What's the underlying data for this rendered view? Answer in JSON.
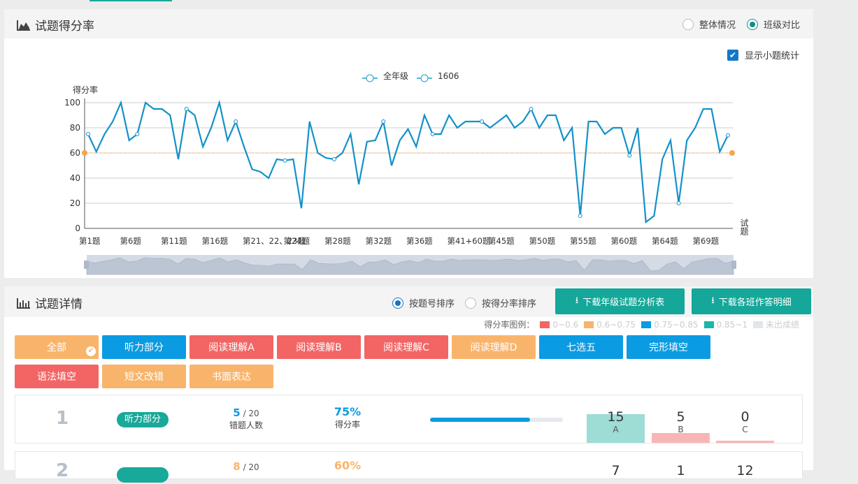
{
  "score_panel": {
    "title": "试题得分率",
    "radio_overall": "整体情况",
    "radio_class": "班级对比",
    "show_sub_label": "显示小题统计"
  },
  "chart_data": {
    "type": "line",
    "ylabel": "得分率",
    "xlabel": "试题",
    "ylim": [
      0,
      100
    ],
    "yticks": [
      0,
      20,
      40,
      60,
      80,
      100
    ],
    "reference_line": 60,
    "legend": [
      "全年级",
      "1606"
    ],
    "x_tick_labels": [
      "第1题",
      "第6题",
      "第11题",
      "第16题",
      "第21、22、23题",
      "第24题",
      "第28题",
      "第32题",
      "第36题",
      "第41+60题",
      "第45题",
      "第50题",
      "第55题",
      "第60题",
      "第64题",
      "第69题"
    ],
    "series": [
      {
        "name": "全年级",
        "values": [
          75,
          61,
          75,
          85,
          100,
          70,
          75,
          100,
          95,
          95,
          90,
          55,
          95,
          90,
          65,
          80,
          100,
          70,
          85,
          65,
          47,
          45,
          40,
          55,
          54,
          55,
          16,
          85,
          60,
          56,
          55,
          60,
          75,
          35,
          69,
          70,
          85,
          50,
          70,
          79,
          65,
          90,
          75,
          75,
          90,
          80,
          85,
          85,
          85,
          80,
          85,
          90,
          80,
          85,
          95,
          80,
          90,
          90,
          70,
          80,
          10,
          85,
          85,
          75,
          80,
          80,
          58,
          80,
          5,
          10,
          55,
          70,
          20,
          70,
          80,
          95,
          95,
          61,
          74
        ]
      }
    ],
    "grid": true,
    "legend_position": "top-center"
  },
  "detail_panel": {
    "title": "试题详情",
    "sort_by_no": "按题号排序",
    "sort_by_score": "按得分率排序",
    "download_grade": "下载年级试题分析表",
    "download_class": "下载各班作答明细",
    "legend_title": "得分率图例：",
    "legend_items": [
      {
        "label": "0~0.6",
        "color": "#f36565"
      },
      {
        "label": "0.6~0.75",
        "color": "#f9b46b"
      },
      {
        "label": "0.75~0.85",
        "color": "#0b9be3"
      },
      {
        "label": "0.85~1",
        "color": "#18b7a8"
      },
      {
        "label": "未出成绩",
        "color": "#e2e6ea"
      }
    ],
    "categories": [
      {
        "label": "全部",
        "color": "#f9b46b",
        "selected": true
      },
      {
        "label": "听力部分",
        "color": "#0b9be3"
      },
      {
        "label": "阅读理解A",
        "color": "#f36565"
      },
      {
        "label": "阅读理解B",
        "color": "#f36565"
      },
      {
        "label": "阅读理解C",
        "color": "#f36565"
      },
      {
        "label": "阅读理解D",
        "color": "#f9b46b"
      },
      {
        "label": "七选五",
        "color": "#0b9be3"
      },
      {
        "label": "完形填空",
        "color": "#0b9be3"
      },
      {
        "label": "语法填空",
        "color": "#f36565"
      },
      {
        "label": "短文改错",
        "color": "#f9b46b"
      },
      {
        "label": "书面表达",
        "color": "#f9b46b"
      }
    ],
    "questions": [
      {
        "no": "1",
        "tag": "听力部分",
        "wrong": "5",
        "wrong_total": "/ 20",
        "wrong_label": "错题人数",
        "rate": "75%",
        "rate_label": "得分率",
        "rate_value": 0.75,
        "rate_color": "#0b9be3",
        "options": [
          {
            "count": "15",
            "label": "A",
            "fill": 0.75,
            "color": "#9edcd6"
          },
          {
            "count": "5",
            "label": "B",
            "fill": 0.25,
            "color": "#f8b5b5"
          },
          {
            "count": "0",
            "label": "C",
            "fill": 0.05,
            "color": "#f8b5b5"
          }
        ]
      },
      {
        "no": "2",
        "tag": "",
        "wrong": "8",
        "wrong_total": "/ 20",
        "wrong_label": "",
        "rate": "60%",
        "rate_label": "",
        "rate_value": 0.6,
        "rate_color": "#f9b46b",
        "options": [
          {
            "count": "7",
            "label": "",
            "fill": 0,
            "color": "#ffffff"
          },
          {
            "count": "1",
            "label": "",
            "fill": 0,
            "color": "#ffffff"
          },
          {
            "count": "12",
            "label": "",
            "fill": 0,
            "color": "#ffffff"
          }
        ]
      }
    ]
  }
}
